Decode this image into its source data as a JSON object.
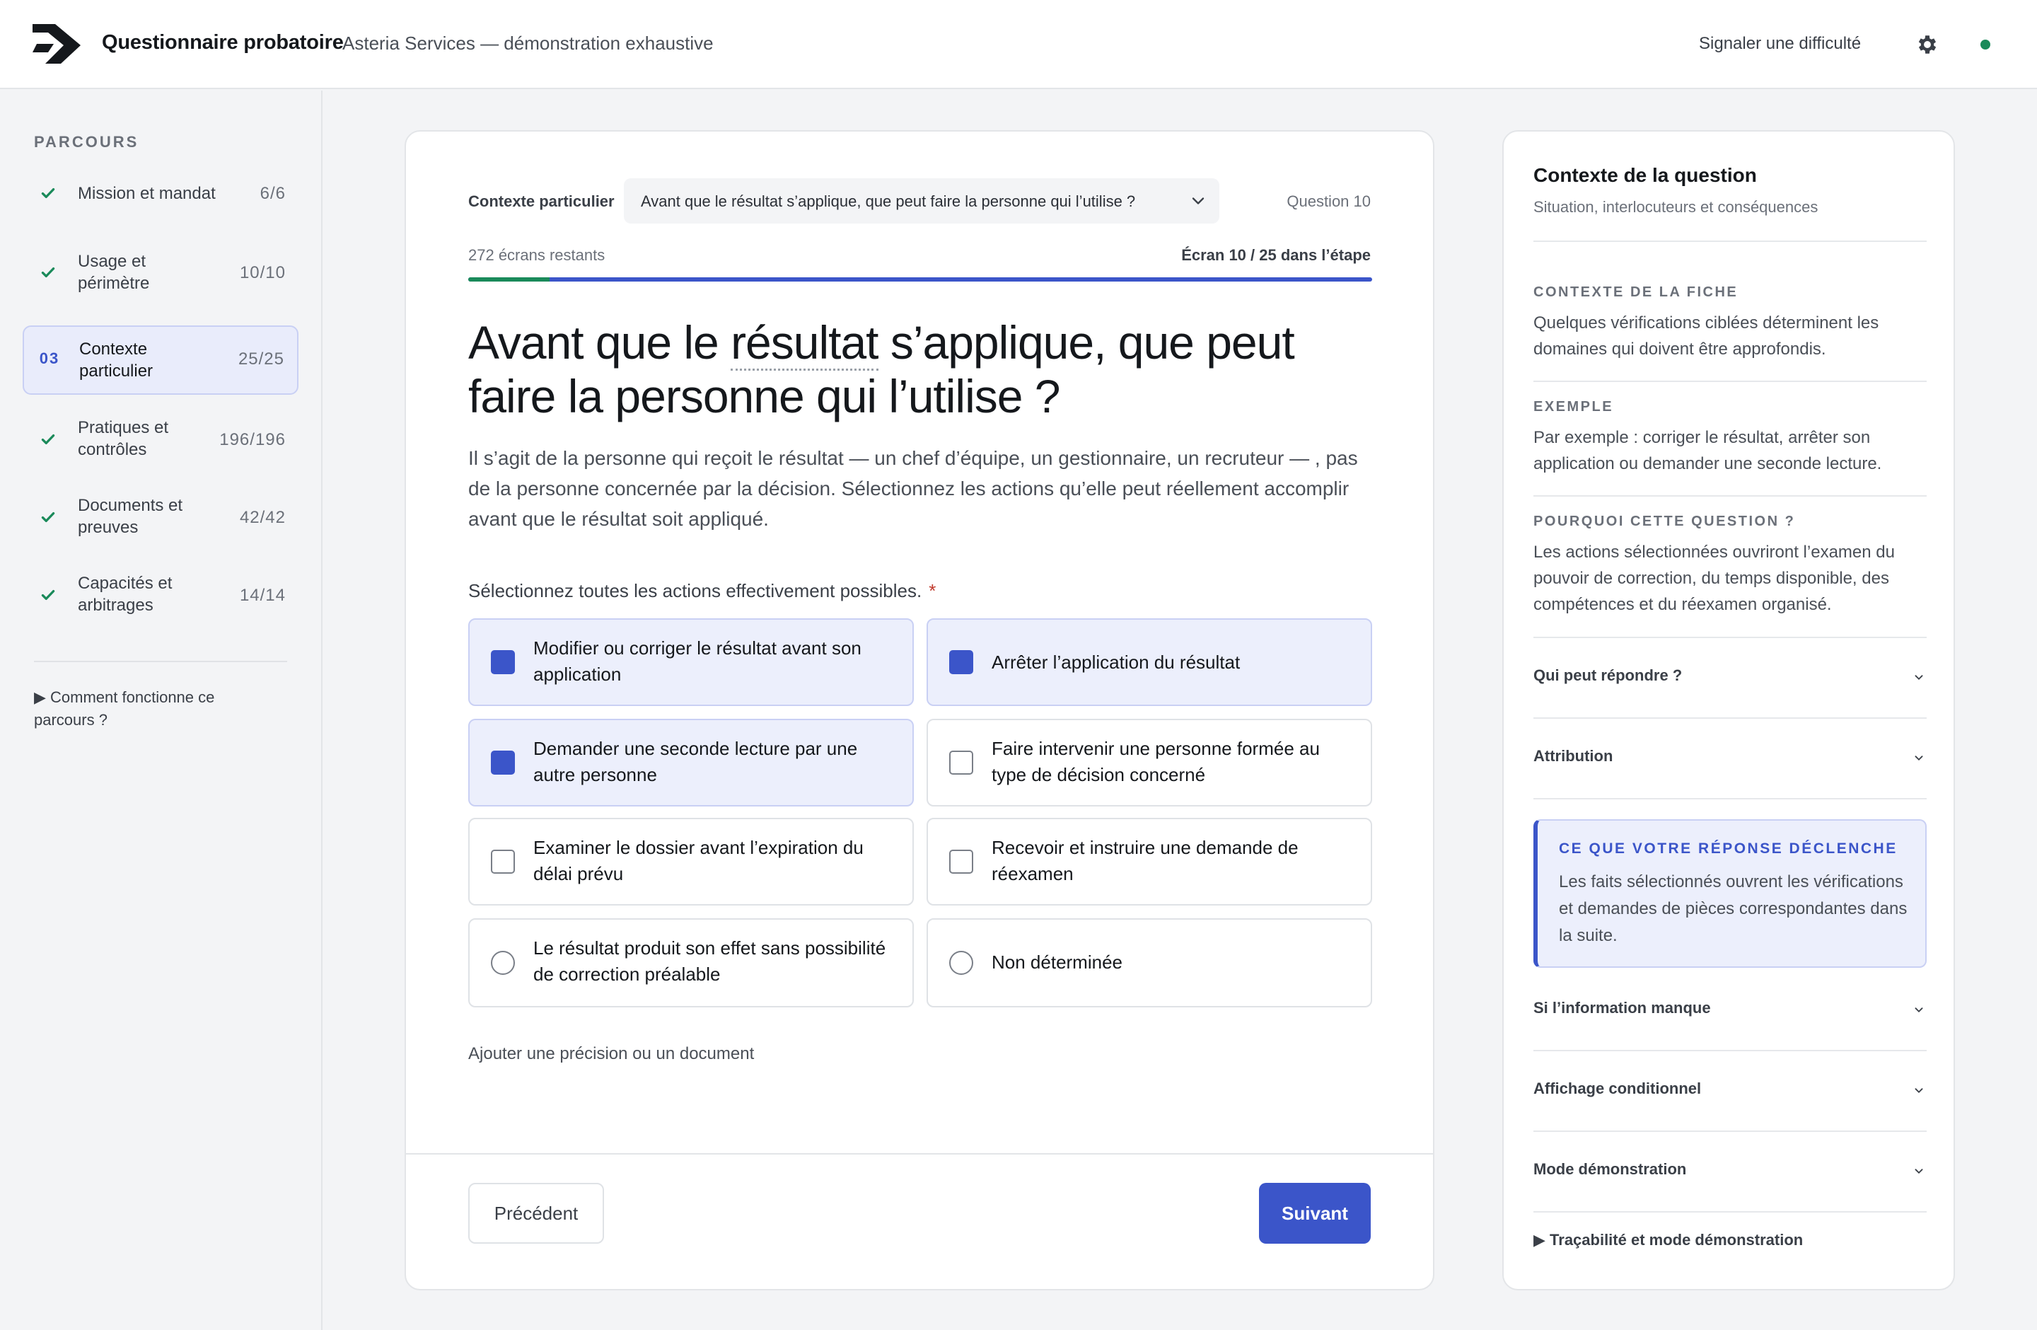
{
  "header": {
    "app_title": "Questionnaire probatoire",
    "app_subtitle": "Asteria Services — démonstration exhaustive",
    "report_link": "Signaler une difficulté",
    "settings_icon": "gear-icon",
    "status_color": "#1a8a5a"
  },
  "sidebar": {
    "heading": "PARCOURS",
    "steps": [
      {
        "label": "Mission et mandat",
        "count": "6/6",
        "state": "done"
      },
      {
        "label": "Usage et périmètre",
        "count": "10/10",
        "state": "done"
      },
      {
        "label": "Contexte particulier",
        "count": "25/25",
        "state": "active",
        "number": "03"
      },
      {
        "label": "Pratiques et contrôles",
        "count": "196/196",
        "state": "done"
      },
      {
        "label": "Documents et preuves",
        "count": "42/42",
        "state": "done"
      },
      {
        "label": "Capacités et arbitrages",
        "count": "14/14",
        "state": "done"
      }
    ],
    "how_it_works": "▶  Comment fonctionne ce parcours ?"
  },
  "main": {
    "context_label": "Contexte particulier",
    "context_select_value": "Avant que le résultat s’applique, que peut faire la personne qui l’utilise ?",
    "question_number": "Question 10",
    "remaining": "272 écrans restants",
    "screen_of": "Écran 10 / 25 dans l’étape",
    "progress": 0.09,
    "title_before": "Avant que le ",
    "title_term": "résultat",
    "title_after": " s’applique, que peut faire la personne qui l’utilise ?",
    "description": "Il s’agit de la personne qui reçoit le résultat — un chef d’équipe, un gestionnaire, un recruteur  — , pas de la personne concernée par la décision. Sélectionnez les actions qu’elle peut réellement accomplir avant que le résultat soit appliqué.",
    "instruction": "Sélectionnez toutes les actions effectivement possibles.",
    "required_mark": "*",
    "options": [
      {
        "label": "Modifier ou corriger le résultat avant son application",
        "selected": true
      },
      {
        "label": "Arrêter l’application du résultat",
        "selected": true
      },
      {
        "label": "Demander une seconde lecture par une autre personne",
        "selected": true
      },
      {
        "label": "Faire intervenir une personne formée au type de décision concerné",
        "selected": false
      },
      {
        "label": "Examiner le dossier avant l’expiration du délai prévu",
        "selected": false
      },
      {
        "label": "Recevoir et instruire une demande de réexamen",
        "selected": false
      },
      {
        "label": "Le résultat produit son effet sans possibilité de correction préalable",
        "selected": false
      },
      {
        "label": "Non déterminée",
        "selected": false
      }
    ],
    "add_precision": "Ajouter une précision ou un document",
    "prev_label": "Précédent",
    "next_label": "Suivant"
  },
  "panel": {
    "title": "Contexte de la question",
    "subtitle": "Situation, interlocuteurs et conséquences",
    "sections": [
      {
        "label": "CONTEXTE DE LA FICHE",
        "text": "Quelques vérifications ciblées déterminent les domaines qui doivent être approfondis."
      },
      {
        "label": "EXEMPLE",
        "text": "Par exemple : corriger le résultat, arrêter son application ou demander une seconde lecture."
      },
      {
        "label": "POURQUOI CETTE QUESTION ?",
        "text": "Les actions sélectionnées ouvriront l’examen du pouvoir de correction, du temps disponible, des compétences et du réexamen organisé."
      }
    ],
    "accordions_top": [
      "Qui peut répondre ?",
      "Attribution"
    ],
    "trigger_label": "CE QUE VOTRE RÉPONSE DÉCLENCHE",
    "trigger_text": "Les faits sélectionnés ouvrent les vérifications et demandes de pièces correspondantes dans la suite.",
    "accordions_bottom": [
      "Si l’information manque",
      "Affichage conditionnel",
      "Mode démonstration"
    ],
    "trace": "▶  Traçabilité et mode démonstration"
  },
  "colors": {
    "accent": "#3b55c9",
    "accent_soft": "#eceffc",
    "success": "#1a8a5a",
    "required": "#c0392b"
  }
}
